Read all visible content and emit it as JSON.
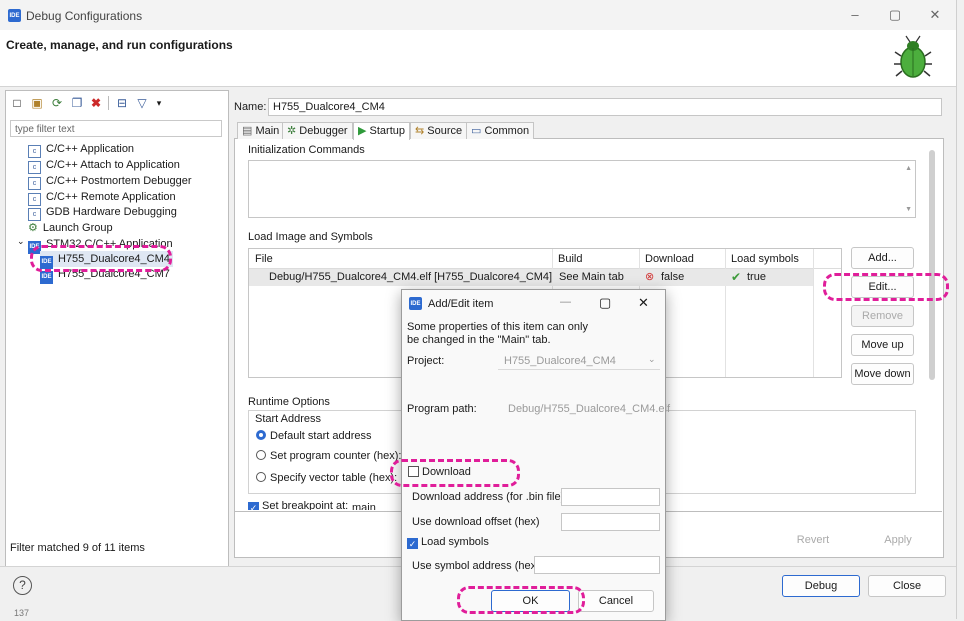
{
  "window": {
    "title": "Debug Configurations",
    "header": "Create, manage, and run configurations",
    "controls": [
      "–",
      "▢",
      "✕"
    ],
    "bug_icon": "bug-icon"
  },
  "left": {
    "filter_placeholder": "type filter text",
    "tree": [
      {
        "label": "C/C++ Application",
        "icon": "c"
      },
      {
        "label": "C/C++ Attach to Application",
        "icon": "c"
      },
      {
        "label": "C/C++ Postmortem Debugger",
        "icon": "c"
      },
      {
        "label": "C/C++ Remote Application",
        "icon": "c"
      },
      {
        "label": "GDB Hardware Debugging",
        "icon": "c"
      },
      {
        "label": "Launch Group",
        "icon": "launch"
      },
      {
        "label": "STM32 C/C++ Application",
        "icon": "ide"
      },
      {
        "label": "H755_Dualcore4_CM4",
        "icon": "ide"
      },
      {
        "label": "H755_Dualcore4_CM7",
        "icon": "ide"
      }
    ],
    "status": "Filter matched 9 of 11 items"
  },
  "right": {
    "name_label": "Name:",
    "name_value": "H755_Dualcore4_CM4",
    "tabs": [
      "Main",
      "Debugger",
      "Startup",
      "Source",
      "Common"
    ],
    "active_tab": "Startup",
    "init_commands": "Initialization Commands",
    "load_image": "Load Image and Symbols",
    "table": {
      "headers": [
        "File",
        "Build",
        "Download",
        "Load symbols"
      ],
      "row": {
        "file": "Debug/H755_Dualcore4_CM4.elf [H755_Dualcore4_CM4]",
        "build": "See Main tab",
        "download": "false",
        "symbols": "true"
      }
    },
    "side_buttons": [
      "Add...",
      "Edit...",
      "Remove",
      "Move up",
      "Move down"
    ],
    "runtime": {
      "title": "Runtime Options",
      "start_address": "Start Address",
      "opt_default": "Default start address",
      "opt_pc": "Set program counter (hex):",
      "opt_vector": "Specify vector table (hex):",
      "breakpoint": "Set breakpoint at:",
      "breakpoint_value": "main"
    },
    "revert": "Revert",
    "apply": "Apply"
  },
  "footer": {
    "help": "?",
    "debug": "Debug",
    "close": "Close",
    "corner_text": "137"
  },
  "dialog": {
    "title": "Add/Edit item",
    "info_line1": "Some properties of this item can only",
    "info_line2": "be changed in the \"Main\" tab.",
    "project_label": "Project:",
    "project_value": "H755_Dualcore4_CM4",
    "path_label": "Program path:",
    "path_value": "Debug/H755_Dualcore4_CM4.elf",
    "download_label": "Download",
    "download_addr_label": "Download address (for .bin file)",
    "download_offset_label": "Use download offset (hex)",
    "load_symbols_label": "Load symbols",
    "symbol_addr_label": "Use symbol address (hex)",
    "ok": "OK",
    "cancel": "Cancel"
  },
  "colors": {
    "highlight": "#e01e9a",
    "accent": "#2d6ad0"
  }
}
